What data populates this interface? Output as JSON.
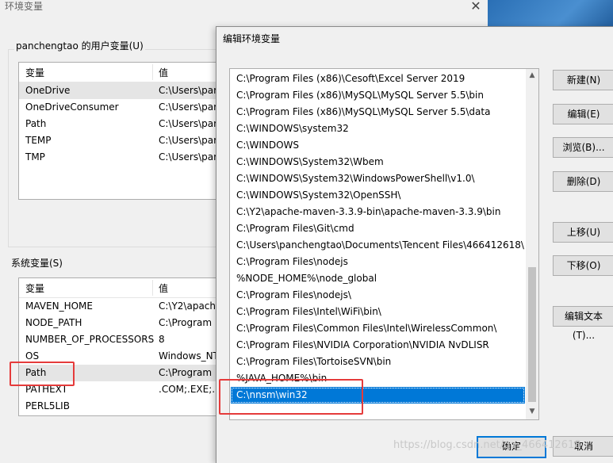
{
  "back_window": {
    "title": "环境变量",
    "close_glyph": "✕",
    "user_group_label": "panchengtao 的用户变量(U)",
    "system_group_label": "系统变量(S)",
    "columns": [
      "变量",
      "值"
    ],
    "user_vars": [
      {
        "name": "OneDrive",
        "value": "C:\\Users\\par"
      },
      {
        "name": "OneDriveConsumer",
        "value": "C:\\Users\\par"
      },
      {
        "name": "Path",
        "value": "C:\\Users\\par"
      },
      {
        "name": "TEMP",
        "value": "C:\\Users\\par"
      },
      {
        "name": "TMP",
        "value": "C:\\Users\\par"
      }
    ],
    "system_vars": [
      {
        "name": "MAVEN_HOME",
        "value": "C:\\Y2\\apache"
      },
      {
        "name": "NODE_PATH",
        "value": "C:\\Program"
      },
      {
        "name": "NUMBER_OF_PROCESSORS",
        "value": "8"
      },
      {
        "name": "OS",
        "value": "Windows_NT"
      },
      {
        "name": "Path",
        "value": "C:\\Program"
      },
      {
        "name": "PATHEXT",
        "value": ".COM;.EXE;.B"
      },
      {
        "name": "PERL5LIB",
        "value": ""
      }
    ]
  },
  "dialog": {
    "title": "编辑环境变量",
    "path_entries": [
      "C:\\Program Files (x86)\\Cesoft\\Excel Server 2019",
      "C:\\Program Files (x86)\\MySQL\\MySQL Server 5.5\\bin",
      "C:\\Program Files (x86)\\MySQL\\MySQL Server 5.5\\data",
      "C:\\WINDOWS\\system32",
      "C:\\WINDOWS",
      "C:\\WINDOWS\\System32\\Wbem",
      "C:\\WINDOWS\\System32\\WindowsPowerShell\\v1.0\\",
      "C:\\WINDOWS\\System32\\OpenSSH\\",
      "C:\\Y2\\apache-maven-3.3.9-bin\\apache-maven-3.3.9\\bin",
      "C:\\Program Files\\Git\\cmd",
      "C:\\Users\\panchengtao\\Documents\\Tencent Files\\466412618\\...",
      "C:\\Program Files\\nodejs",
      "%NODE_HOME%\\node_global",
      "C:\\Program Files\\nodejs\\",
      "C:\\Program Files\\Intel\\WiFi\\bin\\",
      "C:\\Program Files\\Common Files\\Intel\\WirelessCommon\\",
      "C:\\Program Files\\NVIDIA Corporation\\NVIDIA NvDLISR",
      "C:\\Program Files\\TortoiseSVN\\bin",
      "%JAVA_HOME%\\bin",
      "C:\\nnsm\\win32"
    ],
    "selected_index": 19,
    "buttons": {
      "new": "新建(N)",
      "edit": "编辑(E)",
      "browse": "浏览(B)...",
      "delete": "删除(D)",
      "move_up": "上移(U)",
      "move_down": "下移(O)",
      "edit_text": "编辑文本(T)...",
      "ok": "确定",
      "cancel": "取消"
    },
    "scroll_up_glyph": "▲",
    "scroll_down_glyph": "▼"
  },
  "watermark": "https://blog.csdn.net/qq_466412618",
  "colors": {
    "selection": "#0078d7",
    "highlight_box": "#e53b3b"
  }
}
